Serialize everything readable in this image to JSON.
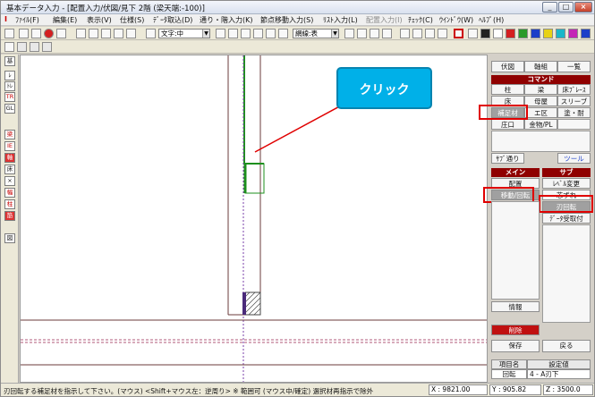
{
  "window": {
    "title": "基本データ入力 - [配置入力/伏図/見下 2階 (梁天端:-100)]",
    "controls": [
      "_",
      "□",
      "×"
    ]
  },
  "menu": [
    "ﾌｧｲﾙ(F)",
    "編集(E)",
    "表示(V)",
    "仕様(S)",
    "ﾃﾞｰﾀ取込(D)",
    "通り・階入力(K)",
    "節点移動入力(S)",
    "ﾘｽﾄ入力(L)",
    "配置入力(I)",
    "ﾁｪｯｸ(C)",
    "ｳｲﾝﾄﾞｳ(W)",
    "ﾍﾙﾌﾟ(H)"
  ],
  "toolbar": {
    "text_select": "文字:中",
    "grid_select": "網線:表",
    "colors": [
      "#222222",
      "#ffffff",
      "#d42020",
      "#2a9a2a",
      "#1c3fc8",
      "#e7d215",
      "#19b7c9",
      "#c425b6",
      "#1c3fc8"
    ]
  },
  "left_tools": [
    "基",
    "ﾚ",
    "ﾄﾚ",
    "TR",
    "GL",
    "梁",
    "IE",
    "軸",
    "床",
    "×",
    "幅",
    "柱",
    "筋",
    "図"
  ],
  "callout": {
    "text": "クリック"
  },
  "panel": {
    "top_buttons": [
      "伏図",
      "軸組",
      "一覧"
    ],
    "command_header": "コマンド",
    "commands": [
      [
        "柱",
        "梁",
        "床ﾌﾞﾚｰｽ"
      ],
      [
        "床",
        "母屋",
        "スリーブ"
      ],
      [
        "補足材",
        "エ区",
        "塗・耐"
      ],
      [
        "庄口",
        "金物/PL",
        ""
      ]
    ],
    "commands_bottom": [
      "ｻﾌﾞ通り",
      "ツール"
    ],
    "main_header": "メイン",
    "sub_header": "サブ",
    "main_items": [
      "配置",
      "移動/回転"
    ],
    "sub_items": [
      "ﾚﾍﾞﾙ変更",
      "芯ずれ",
      "刃回転",
      "ﾃﾞｰﾀ受取付"
    ],
    "info_label": "情報",
    "delete_label": "削除",
    "save_label": "保存",
    "back_label": "戻る",
    "table_headers": [
      "項目名",
      "設定値"
    ],
    "table_rows": [
      [
        "回転",
        "4 - A刃下"
      ]
    ]
  },
  "status": {
    "message": "刃回転する補足材を指示して下さい。(マウス) <Shift+マウス左：逆周り> ※ 範囲可 (マウス中/確定) 選択材再指示で除外",
    "x": "X : 9821.00",
    "y": "Y : 905.82",
    "z": "Z : 3500.0"
  }
}
